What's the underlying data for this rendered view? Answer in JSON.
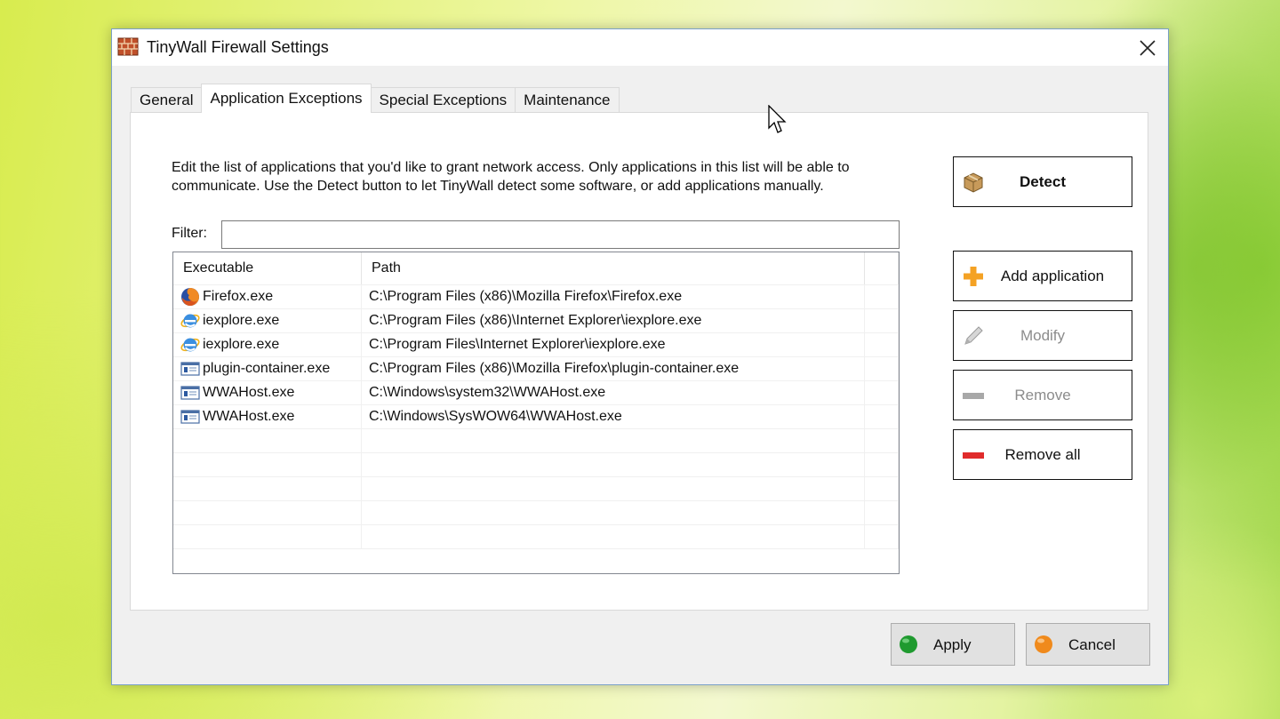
{
  "window": {
    "title": "TinyWall Firewall Settings",
    "icon": "brick-wall-icon"
  },
  "tabs": [
    {
      "label": "General",
      "active": false
    },
    {
      "label": "Application Exceptions",
      "active": true
    },
    {
      "label": "Special Exceptions",
      "active": false
    },
    {
      "label": "Maintenance",
      "active": false
    }
  ],
  "main": {
    "description": "Edit the list of applications that you'd like to grant network access. Only applications in this list will be able to communicate. Use the Detect button to let TinyWall detect some software, or add applications manually.",
    "filter_label": "Filter:",
    "filter_value": ""
  },
  "table": {
    "columns": [
      "Executable",
      "Path"
    ],
    "rows": [
      {
        "executable": "Firefox.exe",
        "path": "C:\\Program Files (x86)\\Mozilla Firefox\\Firefox.exe",
        "icon": "firefox-icon"
      },
      {
        "executable": "iexplore.exe",
        "path": "C:\\Program Files (x86)\\Internet Explorer\\iexplore.exe",
        "icon": "internet-explorer-icon"
      },
      {
        "executable": "iexplore.exe",
        "path": "C:\\Program Files\\Internet Explorer\\iexplore.exe",
        "icon": "internet-explorer-icon"
      },
      {
        "executable": "plugin-container.exe",
        "path": "C:\\Program Files (x86)\\Mozilla Firefox\\plugin-container.exe",
        "icon": "application-icon"
      },
      {
        "executable": "WWAHost.exe",
        "path": "C:\\Windows\\system32\\WWAHost.exe",
        "icon": "application-icon"
      },
      {
        "executable": "WWAHost.exe",
        "path": "C:\\Windows\\SysWOW64\\WWAHost.exe",
        "icon": "application-icon"
      }
    ]
  },
  "side_buttons": {
    "detect": "Detect",
    "add": "Add application",
    "modify": "Modify",
    "remove": "Remove",
    "remove_all": "Remove all"
  },
  "bottom_buttons": {
    "apply": "Apply",
    "cancel": "Cancel"
  },
  "colors": {
    "add_icon": "#f4a224",
    "remove_all_icon": "#e02b2b",
    "apply_icon": "#1f9a2f",
    "cancel_icon": "#f08a1c",
    "disabled_text": "#8c8c8c"
  }
}
